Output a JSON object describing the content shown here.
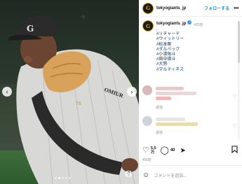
{
  "post": {
    "watermark": "G",
    "carousel_dots": 5,
    "carousel_active": 2
  },
  "header": {
    "username": "tokyogiants_jp",
    "follow_label": "フォローする",
    "more_label": "•••",
    "avatar_glyph": "G"
  },
  "caption": {
    "username": "tokyogiants_jp",
    "time": "4日前",
    "comma": ",",
    "hashtags": [
      "#リチャード",
      "#ウィットリー",
      "#松本剛",
      "#ダルベック",
      "#小濱佑斗",
      "#田中瑛斗",
      "#大勢",
      "#マルティネス"
    ]
  },
  "comments": [
    {
      "reply_label": "返信",
      "avatar_color": "#d9b8b8",
      "blur_color": "#e4caca"
    },
    {
      "reply_label": "返信",
      "avatar_color": "#cfd3dc",
      "blur_color": "#f1dca0"
    }
  ],
  "actions": {
    "likes_line1": "5.5",
    "likes_line2": "万",
    "comments_count": "40"
  },
  "date": "4日前",
  "add_comment": {
    "placeholder": "コメントを追加..."
  },
  "colors": {
    "brand_accent": "#0095f6",
    "giants_orange": "#e8a200"
  },
  "icons": {
    "heart": "heart-icon",
    "comment": "comment-icon",
    "share": "share-icon",
    "bookmark": "bookmark-icon",
    "emoji": "emoji-icon",
    "verified": "verified-badge-icon"
  }
}
